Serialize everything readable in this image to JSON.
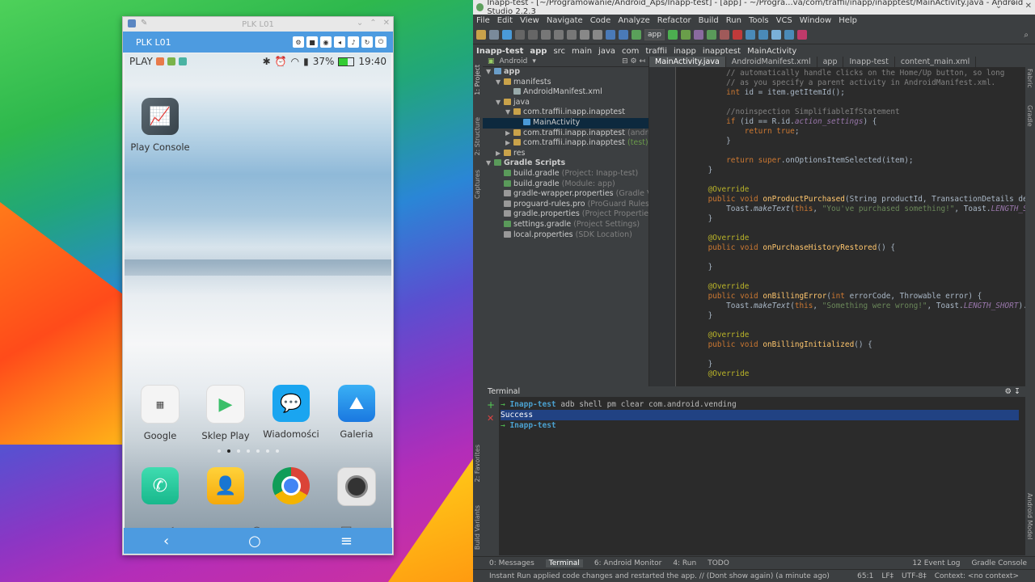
{
  "emulator": {
    "window_title": "PLK L01",
    "device_name": "PLK L01",
    "status": {
      "carrier": "PLAY",
      "battery": "37%",
      "time": "19:40"
    },
    "apps_top": [
      {
        "label": "Play Console"
      }
    ],
    "dock_apps": [
      {
        "label": "Google"
      },
      {
        "label": "Sklep Play"
      },
      {
        "label": "Wiadomości"
      },
      {
        "label": "Galeria"
      }
    ]
  },
  "studio": {
    "title": "Inapp-test - [~/Programowanie/Android_Aps/Inapp-test] - [app] - ~/Progra...va/com/traffii/inapp/inapptest/MainActivity.java - Android Studio 2.2.3",
    "menu": [
      "File",
      "Edit",
      "View",
      "Navigate",
      "Code",
      "Analyze",
      "Refactor",
      "Build",
      "Run",
      "Tools",
      "VCS",
      "Window",
      "Help"
    ],
    "run_config": "app",
    "breadcrumbs": [
      "Inapp-test",
      "app",
      "src",
      "main",
      "java",
      "com",
      "traffii",
      "inapp",
      "inapptest",
      "MainActivity"
    ],
    "project_view": "Android",
    "tabs": [
      "MainActivity.java",
      "AndroidManifest.xml",
      "app",
      "Inapp-test",
      "content_main.xml"
    ],
    "tree": [
      {
        "label": "app",
        "hint": "",
        "depth": 0,
        "arrow": "▼"
      },
      {
        "label": "manifests",
        "hint": "",
        "depth": 1,
        "arrow": "▼"
      },
      {
        "label": "AndroidManifest.xml",
        "hint": "",
        "depth": 2,
        "arrow": ""
      },
      {
        "label": "java",
        "hint": "",
        "depth": 1,
        "arrow": "▼"
      },
      {
        "label": "com.traffii.inapp.inapptest",
        "hint": "",
        "depth": 2,
        "arrow": "▼"
      },
      {
        "label": "MainActivity",
        "hint": "",
        "depth": 3,
        "arrow": ""
      },
      {
        "label": "com.traffii.inapp.inapptest",
        "hint": "(androi",
        "depth": 2,
        "arrow": "▶"
      },
      {
        "label": "com.traffii.inapp.inapptest",
        "hint": "(test)",
        "depth": 2,
        "arrow": "▶"
      },
      {
        "label": "res",
        "hint": "",
        "depth": 1,
        "arrow": "▶"
      },
      {
        "label": "Gradle Scripts",
        "hint": "",
        "depth": 0,
        "arrow": "▼"
      },
      {
        "label": "build.gradle",
        "hint": "(Project: Inapp-test)",
        "depth": 1,
        "arrow": ""
      },
      {
        "label": "build.gradle",
        "hint": "(Module: app)",
        "depth": 1,
        "arrow": ""
      },
      {
        "label": "gradle-wrapper.properties",
        "hint": "(Gradle Vers",
        "depth": 1,
        "arrow": ""
      },
      {
        "label": "proguard-rules.pro",
        "hint": "(ProGuard Rules for",
        "depth": 1,
        "arrow": ""
      },
      {
        "label": "gradle.properties",
        "hint": "(Project Properties)",
        "depth": 1,
        "arrow": ""
      },
      {
        "label": "settings.gradle",
        "hint": "(Project Settings)",
        "depth": 1,
        "arrow": ""
      },
      {
        "label": "local.properties",
        "hint": "(SDK Location)",
        "depth": 1,
        "arrow": ""
      }
    ],
    "terminal": {
      "title": "Terminal",
      "lines": [
        {
          "prompt": "Inapp-test",
          "cmd": " adb shell pm clear com.android.vending"
        },
        {
          "prompt": "",
          "cmd": "Success"
        },
        {
          "prompt": "Inapp-test",
          "cmd": ""
        }
      ]
    },
    "bottom_tabs": [
      "0: Messages",
      "Terminal",
      "6: Android Monitor",
      "4: Run",
      "TODO"
    ],
    "bottom_tabs_right": [
      "12 Event Log",
      "Gradle Console"
    ],
    "status_message": "Instant Run applied code changes and restarted the app. // (Dont show again) (a minute ago)",
    "status_right": [
      "65:1",
      "LF‡",
      "UTF-8‡",
      "Context: <no context>"
    ]
  }
}
